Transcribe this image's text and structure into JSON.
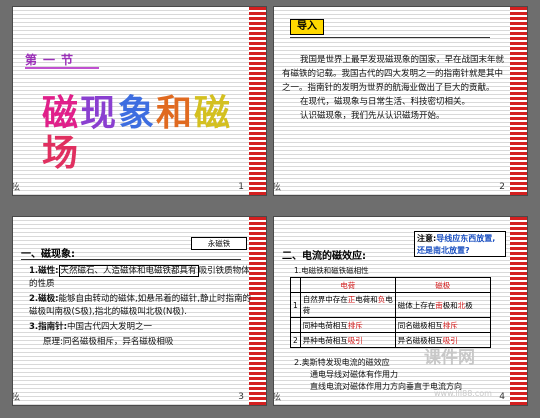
{
  "slide1": {
    "section": "第一节",
    "title_chars": [
      {
        "ch": "磁",
        "color": "#e0208a"
      },
      {
        "ch": "现",
        "color": "#8a3fd0"
      },
      {
        "ch": "象",
        "color": "#3d6de0"
      },
      {
        "ch": "和",
        "color": "#e06a20"
      },
      {
        "ch": "磁",
        "color": "#d4c020"
      },
      {
        "ch": "场",
        "color": "#e03060"
      }
    ],
    "footer": "吆",
    "page": "1"
  },
  "slide2": {
    "intro": "导入",
    "lines": [
      "我国是世界上最早发现磁现象的国家，早在战国末年就有磁铁的记载。我国古代的四大发明之一的指南针就是其中之一。指南针的发明为世界的航海业做出了巨大的贡献。",
      "在现代，磁现象与日常生活、科技密切相关。",
      "认识磁现象，我们先从认识磁场开始。"
    ],
    "footer": "吆",
    "page": "2"
  },
  "slide3": {
    "heading": "一、磁现象:",
    "callout": "永磁铁",
    "items": [
      {
        "label": "1.磁性:",
        "boxed": "天然磁石、人造磁体和电磁铁都具有",
        "rest": "吸引铁质物体的性质"
      },
      {
        "label": "2.磁极:",
        "boxed": "",
        "rest": "能够自由转动的磁体,如悬吊着的磁针,静止时指南的磁极叫南极(S极),指北的磁极叫北极(N极)."
      },
      {
        "label": "3.指南针:",
        "boxed": "",
        "rest": "中国古代四大发明之一"
      },
      {
        "label": "原理:",
        "boxed": "",
        "rest": "同名磁极相斥，异名磁极相吸"
      }
    ],
    "footer": "吆",
    "page": "3"
  },
  "slide4": {
    "heading": "二、电流的磁效应:",
    "note_label": "注意:",
    "note": "导线应东西放置,还是南北放置?",
    "subheading": "1.电磁铁和磁铁磁相性",
    "table": {
      "headers": [
        "电荷",
        "磁极"
      ],
      "rows": [
        {
          "n": "1",
          "a": [
            "自然界中存在",
            "正",
            "电荷和",
            "负",
            "电荷"
          ],
          "b": [
            "磁体上存在",
            "南",
            "极和",
            "北",
            "极"
          ]
        },
        {
          "n": "",
          "a": [
            "同种电荷相互",
            "排斥",
            ""
          ],
          "b": [
            "同名磁极相互",
            "排斥",
            ""
          ]
        },
        {
          "n": "2",
          "a": [
            "异种电荷相互",
            "吸引",
            ""
          ],
          "b": [
            "异名磁极相互",
            "吸引",
            ""
          ]
        }
      ]
    },
    "line2": "2.奥斯特发现电流的磁效应",
    "line3": "通电导线对磁体有作用力",
    "line4": "直线电流对磁体作用力方向垂直于电流方向",
    "watermark": "课件网",
    "watermark_url": "www.lll88.com",
    "page": "4",
    "footer": "吆"
  }
}
